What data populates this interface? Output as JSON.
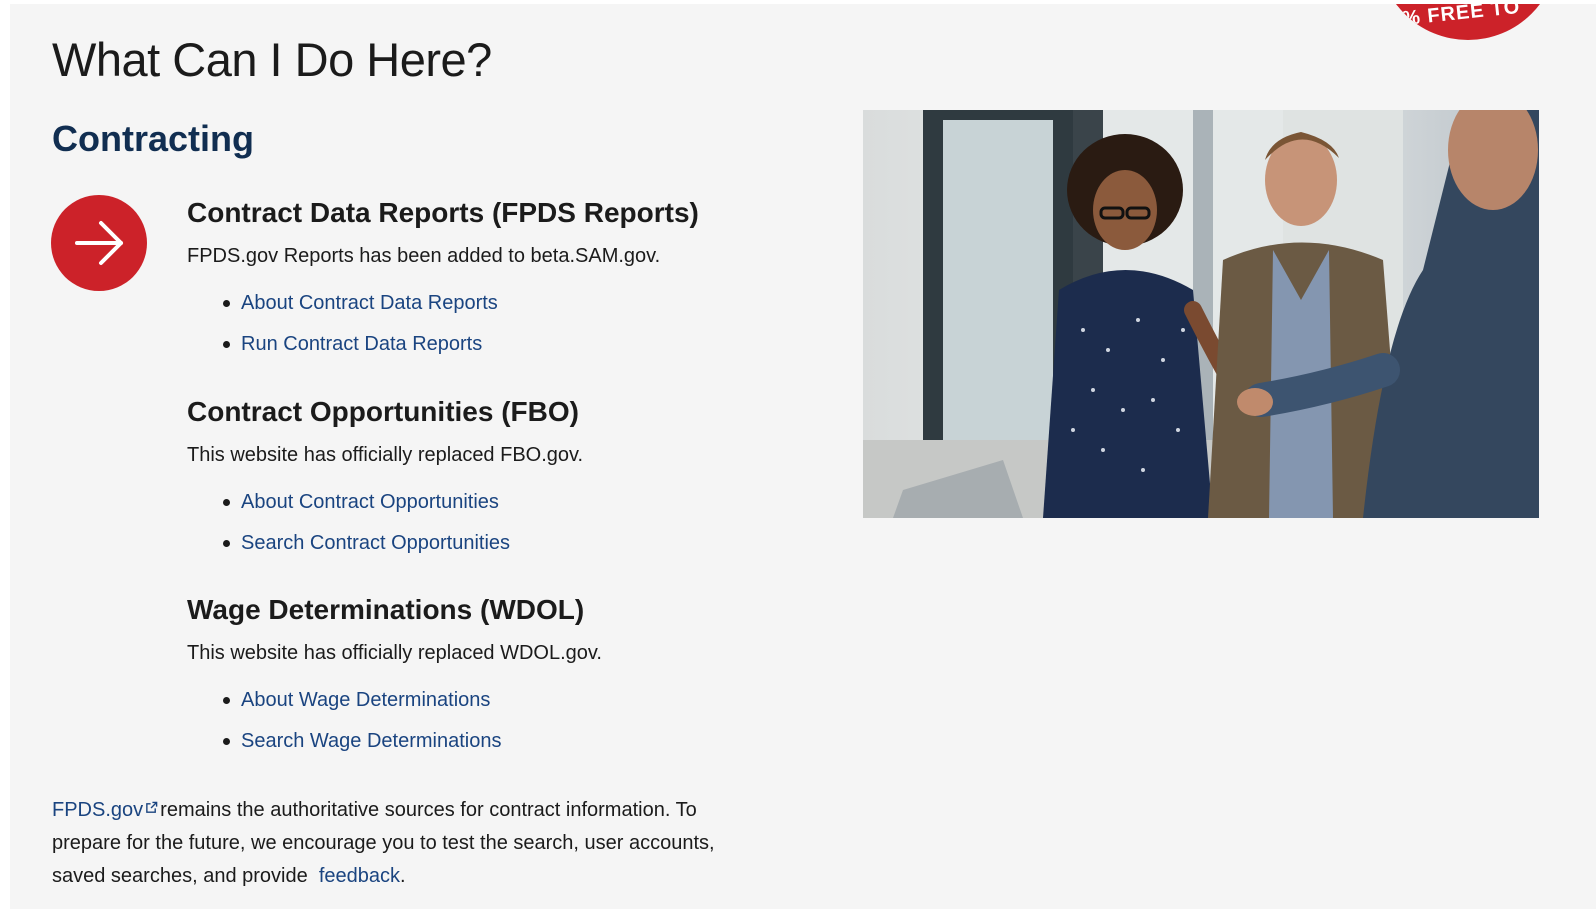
{
  "badge": {
    "text": "% FREE TO"
  },
  "page_title": "What Can I Do Here?",
  "section_title": "Contracting",
  "icons": {
    "arrow": "arrow-right-icon",
    "external": "external-link-icon"
  },
  "colors": {
    "accent_red": "#cc2229",
    "heading_navy": "#112e51",
    "link_blue": "#1a4480",
    "background": "#f5f5f5"
  },
  "blocks": [
    {
      "title": "Contract Data Reports (FPDS Reports)",
      "description": "FPDS.gov Reports has been added to beta.SAM.gov.",
      "links": [
        "About Contract Data Reports",
        "Run Contract Data Reports"
      ]
    },
    {
      "title": "Contract Opportunities (FBO)",
      "description": "This website has officially replaced FBO.gov.",
      "links": [
        "About Contract Opportunities",
        "Search Contract Opportunities"
      ]
    },
    {
      "title": "Wage Determinations (WDOL)",
      "description": "This website has officially replaced WDOL.gov.",
      "links": [
        "About Wage Determinations",
        "Search Wage Determinations"
      ]
    }
  ],
  "footer": {
    "link_fpds": "FPDS.gov",
    "text_1": "remains the authoritative sources for contract information. To prepare for the future, we encourage you to test the search, user accounts, saved searches, and provide",
    "link_feedback": "feedback",
    "text_end": "."
  }
}
